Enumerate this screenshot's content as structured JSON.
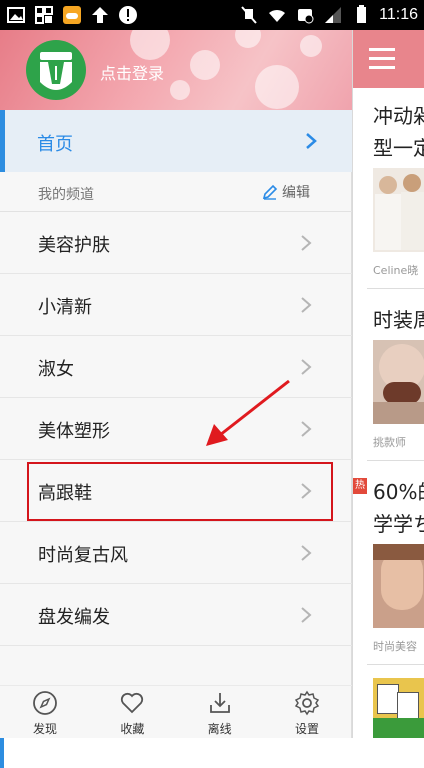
{
  "status_bar": {
    "time": "11:16"
  },
  "drawer": {
    "login_text": "点击登录",
    "home": {
      "label": "首页"
    },
    "section": {
      "label": "我的频道",
      "edit_label": "编辑"
    },
    "channels": [
      {
        "label": "美容护肤"
      },
      {
        "label": "小清新"
      },
      {
        "label": "淑女"
      },
      {
        "label": "美体塑形"
      },
      {
        "label": "高跟鞋"
      },
      {
        "label": "时尚复古风"
      },
      {
        "label": "盘发编发"
      }
    ],
    "bottom_nav": [
      {
        "label": "发现",
        "icon": "compass-icon"
      },
      {
        "label": "收藏",
        "icon": "heart-icon"
      },
      {
        "label": "离线",
        "icon": "download-icon"
      },
      {
        "label": "设置",
        "icon": "gear-icon"
      }
    ]
  },
  "peek": {
    "articles": [
      {
        "title_line1": "冲动剁",
        "title_line2": "型一定",
        "source": "Celine晓"
      },
      {
        "title_line1": "时装周",
        "source": "挑款师"
      },
      {
        "title_line1": "60%的",
        "title_line2": "学学ち",
        "source": "时尚美容",
        "badge": "热"
      }
    ]
  },
  "colors": {
    "accent_blue": "#2b8be6",
    "header_pink": "#e8858c",
    "highlight_red": "#d4151c"
  }
}
